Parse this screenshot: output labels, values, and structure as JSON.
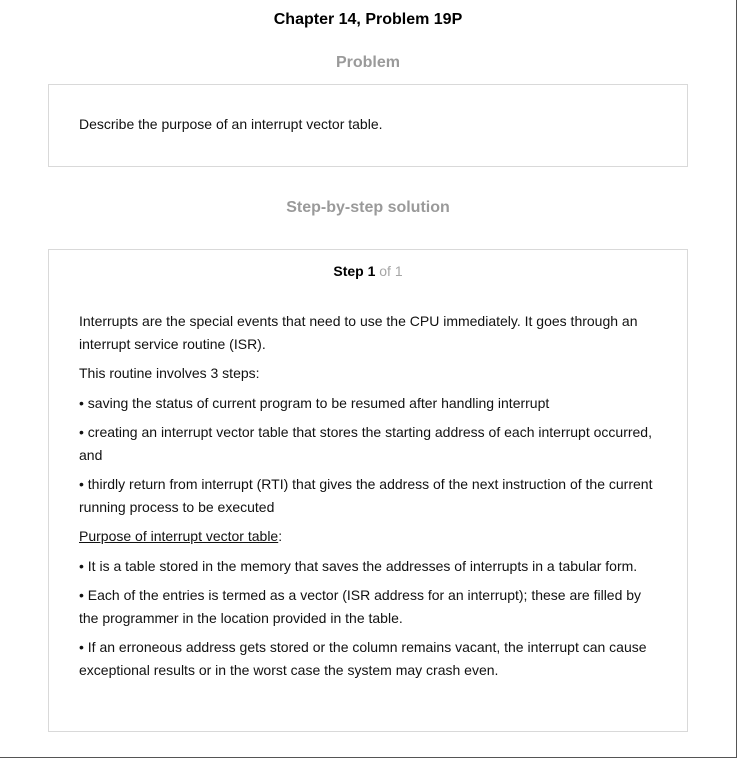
{
  "header": {
    "title": "Chapter 14, Problem 19P"
  },
  "problem": {
    "heading": "Problem",
    "text": "Describe the purpose of an interrupt vector table."
  },
  "solution": {
    "heading": "Step-by-step solution",
    "step_label": "Step 1",
    "step_of": "of 1",
    "paragraphs": [
      "Interrupts are the special events that need to use the CPU immediately. It goes through an interrupt service routine (ISR).",
      "This routine involves 3 steps:",
      "• saving the status of current program to be resumed after handling interrupt",
      "• creating an interrupt vector table that stores the starting address of each interrupt occurred, and",
      "• thirdly return from interrupt (RTI) that gives the address of the next instruction of the current running process to be executed"
    ],
    "purpose_label": "Purpose of interrupt vector table",
    "purpose_colon": ":",
    "purpose_points": [
      "• It is a table stored in the memory that saves the addresses of interrupts in a tabular form.",
      "• Each of the entries is termed as a vector (ISR address for an interrupt); these are filled by the programmer in the location provided in the table.",
      "• If an erroneous address gets stored or the column remains vacant, the interrupt can cause exceptional results or in the worst case the system may crash even."
    ]
  }
}
